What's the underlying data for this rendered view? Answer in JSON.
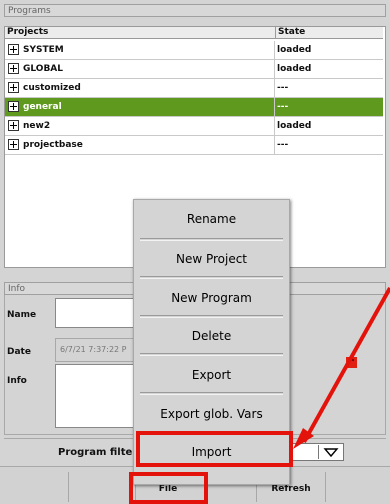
{
  "programs": {
    "title": "Programs",
    "columns": {
      "projects": "Projects",
      "state": "State"
    },
    "rows": [
      {
        "name": "SYSTEM",
        "state": "loaded"
      },
      {
        "name": "GLOBAL",
        "state": "loaded"
      },
      {
        "name": "customized",
        "state": "---"
      },
      {
        "name": "general",
        "state": "---"
      },
      {
        "name": "new2",
        "state": "loaded"
      },
      {
        "name": "projectbase",
        "state": "---"
      }
    ],
    "selected_row": "general",
    "selected_color": "#5f9a1e"
  },
  "info": {
    "title": "Info",
    "name_label": "Name",
    "date_label": "Date",
    "date_value": "6/7/21 7:37:22 P",
    "info_label": "Info"
  },
  "context_menu": {
    "items": [
      "Rename",
      "New Project",
      "New Program",
      "Delete",
      "Export",
      "Export glob. Vars",
      "Import"
    ]
  },
  "filter": {
    "label": "Program filter:"
  },
  "toolbar": {
    "file_label": "File",
    "refresh_label": "Refresh"
  },
  "highlight_color": "#e3120b",
  "icons": {
    "expand": "plus-box-icon",
    "dropdown": "triangle-down-icon",
    "status": "red-status-icon"
  }
}
